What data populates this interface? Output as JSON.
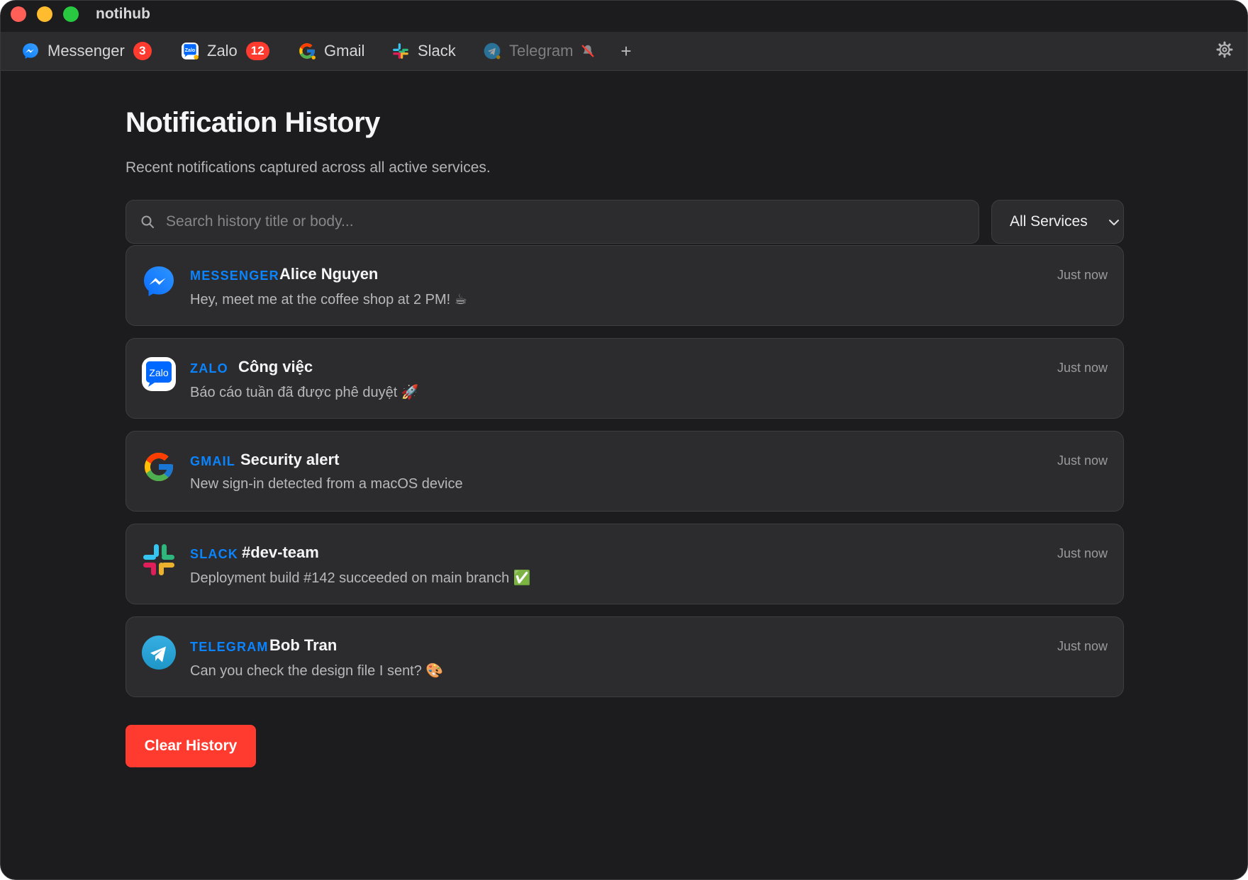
{
  "window": {
    "title": "notihub"
  },
  "tabs": [
    {
      "label": "Messenger",
      "badge": "3",
      "icon": "messenger-icon"
    },
    {
      "label": "Zalo",
      "badge": "12",
      "icon": "zalo-icon"
    },
    {
      "label": "Gmail",
      "icon": "gmail-icon"
    },
    {
      "label": "Slack",
      "icon": "slack-icon"
    },
    {
      "label": "Telegram",
      "icon": "telegram-icon",
      "muted": true,
      "status_icon": "muted-bell-icon"
    }
  ],
  "toolbar": {
    "add_label": "+",
    "settings_icon": "gear-icon"
  },
  "page": {
    "title": "Notification History",
    "subtitle": "Recent notifications captured across all active services."
  },
  "search": {
    "placeholder": "Search history title or body...",
    "value": ""
  },
  "filter": {
    "selected": "All Services"
  },
  "notifications": [
    {
      "service": "MESSENGER",
      "title": "Alice Nguyen",
      "body": "Hey, meet me at the coffee shop at 2 PM! ☕",
      "time": "Just now",
      "icon": "messenger-icon"
    },
    {
      "service": "ZALO",
      "title": "Công việc",
      "body": "Báo cáo tuần đã được phê duyệt 🚀",
      "time": "Just now",
      "icon": "zalo-icon"
    },
    {
      "service": "GMAIL",
      "title": "Security alert",
      "body": "New sign-in detected from a macOS device",
      "time": "Just now",
      "icon": "google-icon"
    },
    {
      "service": "SLACK",
      "title": "#dev-team",
      "body": "Deployment build #142 succeeded on main branch ✅",
      "time": "Just now",
      "icon": "slack-icon"
    },
    {
      "service": "TELEGRAM",
      "title": "Bob Tran",
      "body": "Can you check the design file I sent? 🎨",
      "time": "Just now",
      "icon": "telegram-icon"
    }
  ],
  "actions": {
    "clear_label": "Clear History"
  },
  "colors": {
    "background": "#1c1c1e",
    "card": "#2c2c2e",
    "accent": "#0a84ff",
    "danger": "#ff3b30"
  }
}
